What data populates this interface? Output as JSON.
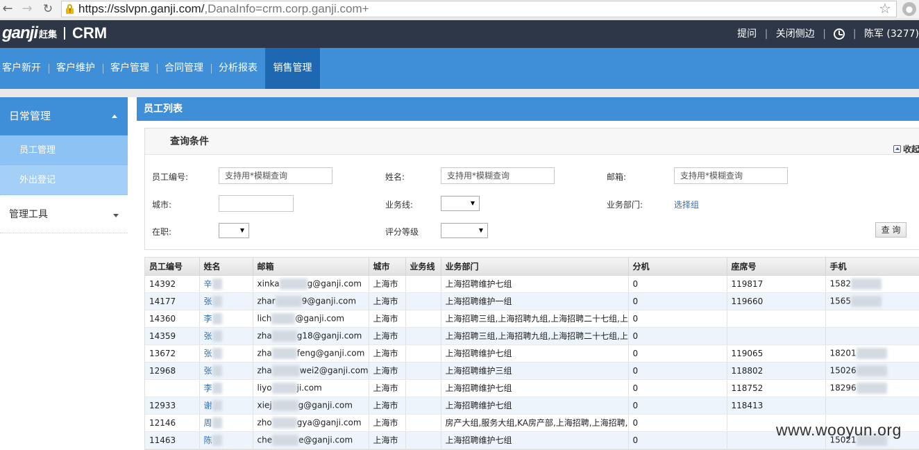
{
  "browser": {
    "url_main": "https://sslvpn.ganji.com/",
    "url_rest": ",DanaInfo=crm.corp.ganji.com+"
  },
  "header": {
    "logo_en": "ganji",
    "logo_cn": "赶集",
    "product": "CRM",
    "links": [
      "提问",
      "关闭侧边"
    ],
    "user": "陈军 (3277)"
  },
  "mainnav": {
    "tabs": [
      {
        "label": "客户新开",
        "active": false
      },
      {
        "label": "客户维护",
        "active": false
      },
      {
        "label": "客户管理",
        "active": false
      },
      {
        "label": "合同管理",
        "active": false
      },
      {
        "label": "分析报表",
        "active": false
      },
      {
        "label": "销售管理",
        "active": true
      }
    ]
  },
  "sidebar": {
    "group": "日常管理",
    "items": [
      "员工管理",
      "外出登记"
    ],
    "group2": "管理工具"
  },
  "panel": {
    "title": "员工列表",
    "query_title": "查询条件",
    "collapse": "收起",
    "fields": {
      "emp_no_label": "员工编号:",
      "emp_no_placeholder": "支持用*模糊查询",
      "name_label": "姓名:",
      "name_placeholder": "支持用*模糊查询",
      "email_label": "邮箱:",
      "email_placeholder": "支持用*模糊查询",
      "city_label": "城市:",
      "bizline_label": "业务线:",
      "dept_label": "业务部门:",
      "dept_link": "选择组",
      "onjob_label": "在职:",
      "grade_label": "评分等级"
    },
    "query_button": "查 询"
  },
  "table": {
    "columns": [
      "员工编号",
      "姓名",
      "邮箱",
      "城市",
      "业务线",
      "业务部门",
      "分机",
      "座席号",
      "手机"
    ],
    "rows": [
      {
        "id": "14392",
        "name": "辛",
        "email_a": "xinka",
        "email_b": "g@ganji.com",
        "city": "上海市",
        "line": "",
        "dept": "上海招聘维护七组",
        "ext": "0",
        "seat": "119817",
        "phone": "1582"
      },
      {
        "id": "14177",
        "name": "张",
        "email_a": "zhar",
        "email_b": "9@ganji.com",
        "city": "上海市",
        "line": "",
        "dept": "上海招聘维护一组",
        "ext": "0",
        "seat": "119660",
        "phone": "1565"
      },
      {
        "id": "14360",
        "name": "李",
        "email_a": "lich",
        "email_b": "@ganji.com",
        "city": "上海市",
        "line": "",
        "dept": "上海招聘三组,上海招聘九组,上海招聘二十七组,上",
        "ext": "0",
        "seat": "",
        "phone": ""
      },
      {
        "id": "14359",
        "name": "张",
        "email_a": "zha",
        "email_b": "g18@ganji.com",
        "city": "上海市",
        "line": "",
        "dept": "上海招聘三组,上海招聘九组,上海招聘二十七组,上",
        "ext": "0",
        "seat": "",
        "phone": ""
      },
      {
        "id": "13672",
        "name": "张",
        "email_a": "zha",
        "email_b": "feng@ganji.com",
        "city": "上海市",
        "line": "",
        "dept": "上海招聘维护七组",
        "ext": "0",
        "seat": "119065",
        "phone": "18201"
      },
      {
        "id": "12968",
        "name": "张",
        "email_a": "zha",
        "email_b": "wei2@ganji.com",
        "city": "上海市",
        "line": "",
        "dept": "上海招聘维护三组",
        "ext": "0",
        "seat": "118802",
        "phone": "15026"
      },
      {
        "id": "",
        "name": "李",
        "email_a": "liyo",
        "email_b": "ji.com",
        "city": "上海市",
        "line": "",
        "dept": "上海招聘维护七组",
        "ext": "0",
        "seat": "118752",
        "phone": "18296"
      },
      {
        "id": "12933",
        "name": "谢",
        "email_a": "xiej",
        "email_b": "g@ganji.com",
        "city": "上海市",
        "line": "",
        "dept": "上海招聘维护七组",
        "ext": "0",
        "seat": "118413",
        "phone": ""
      },
      {
        "id": "12146",
        "name": "周",
        "email_a": "zho",
        "email_b": "gya@ganji.com",
        "city": "上海市",
        "line": "",
        "dept": "房产大组,服务大组,KA房产部,上海招聘,上海招聘,",
        "ext": "0",
        "seat": "",
        "phone": ""
      },
      {
        "id": "11463",
        "name": "陈",
        "email_a": "che",
        "email_b": "e@ganji.com",
        "city": "上海市",
        "line": "",
        "dept": "上海招聘维护七组",
        "ext": "0",
        "seat": "",
        "phone": "15021"
      }
    ]
  },
  "watermark": "www.wooyun.org"
}
